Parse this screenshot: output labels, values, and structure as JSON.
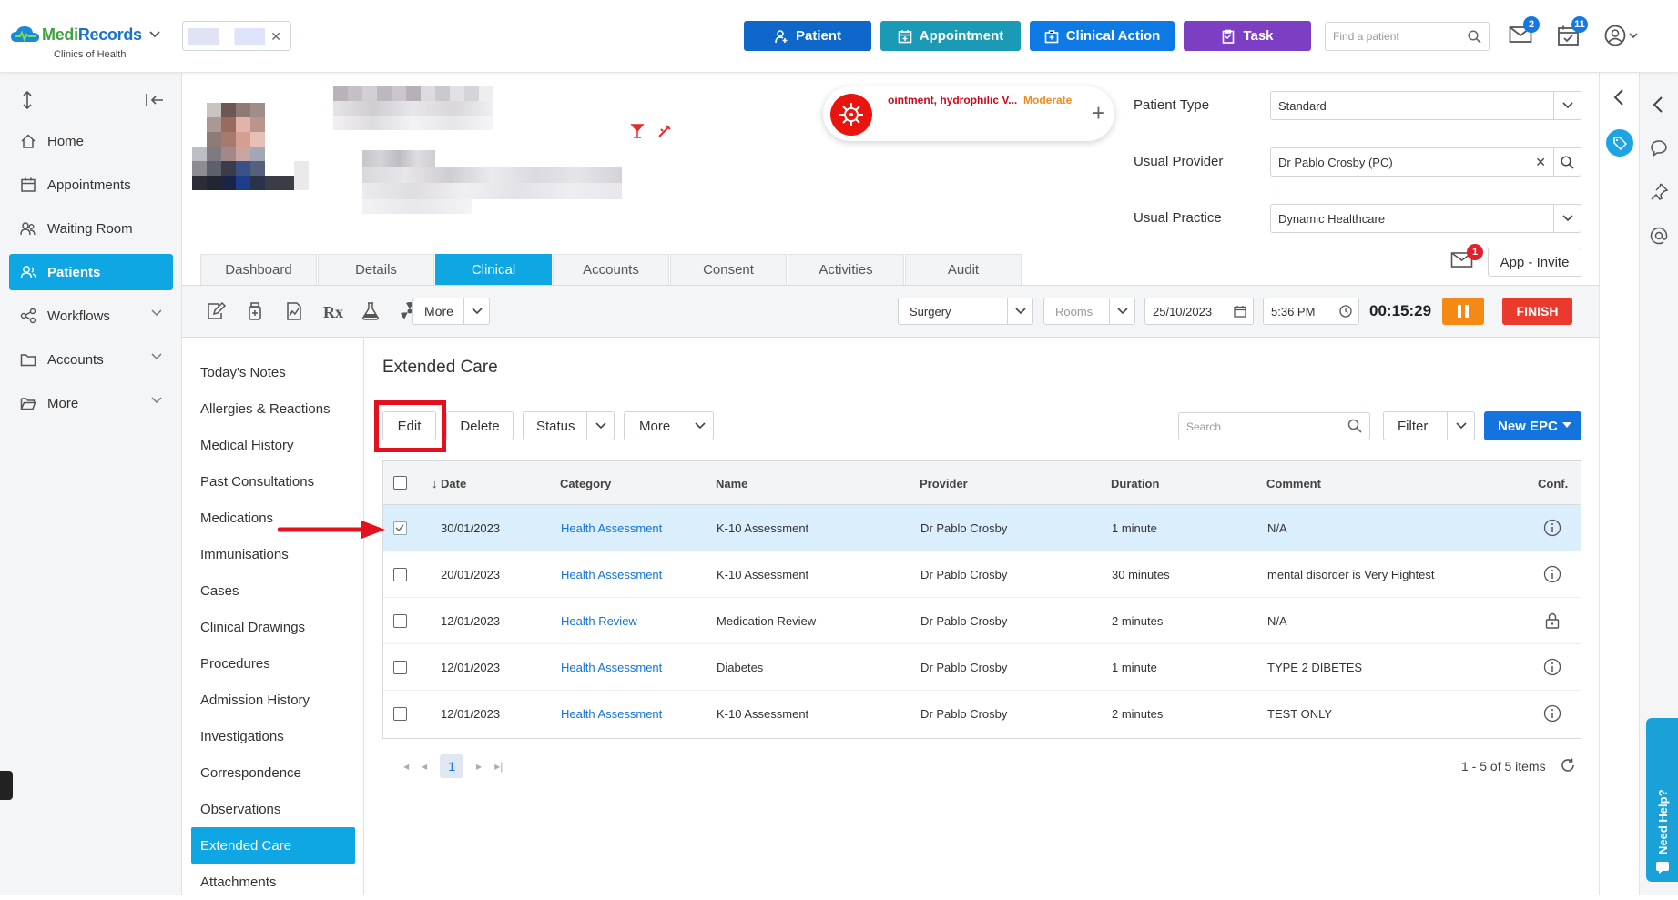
{
  "brand": {
    "name_part1": "Medi",
    "name_part2": "Records",
    "subtitle": "Clinics of Health"
  },
  "header": {
    "buttons": {
      "patient": "Patient",
      "appointment": "Appointment",
      "clinical_action": "Clinical Action",
      "task": "Task"
    },
    "find_patient_placeholder": "Find a patient",
    "mail_badge": "2",
    "tasks_badge": "11"
  },
  "sidebar": {
    "items": [
      {
        "label": "Home"
      },
      {
        "label": "Appointments"
      },
      {
        "label": "Waiting Room"
      },
      {
        "label": "Patients"
      },
      {
        "label": "Workflows"
      },
      {
        "label": "Accounts"
      },
      {
        "label": "More"
      }
    ]
  },
  "patient": {
    "alert": {
      "allergen": "ointment, hydrophilic V...",
      "severity": "Moderate"
    },
    "fields": {
      "patient_type_label": "Patient Type",
      "patient_type_value": "Standard",
      "usual_provider_label": "Usual Provider",
      "usual_provider_value": "Dr Pablo Crosby (PC)",
      "usual_practice_label": "Usual Practice",
      "usual_practice_value": "Dynamic Healthcare"
    },
    "tabs": [
      "Dashboard",
      "Details",
      "Clinical",
      "Accounts",
      "Consent",
      "Activities",
      "Audit"
    ],
    "message_badge": "1",
    "app_invite": "App - Invite"
  },
  "toolbar": {
    "more": "More",
    "surgery": "Surgery",
    "rooms": "Rooms",
    "date": "25/10/2023",
    "time": "5:36 PM",
    "timer": "00:15:29",
    "finish": "FINISH"
  },
  "clinical_nav": [
    "Today's Notes",
    "Allergies & Reactions",
    "Medical History",
    "Past Consultations",
    "Medications",
    "Immunisations",
    "Cases",
    "Clinical Drawings",
    "Procedures",
    "Admission History",
    "Investigations",
    "Correspondence",
    "Observations",
    "Extended Care",
    "Attachments"
  ],
  "main": {
    "title": "Extended Care",
    "actions": {
      "edit": "Edit",
      "delete": "Delete",
      "status": "Status",
      "more": "More",
      "filter": "Filter",
      "new_epc": "New EPC"
    },
    "search_placeholder": "Search",
    "columns": [
      "Date",
      "Category",
      "Name",
      "Provider",
      "Duration",
      "Comment",
      "Conf."
    ],
    "rows": [
      {
        "date": "30/01/2023",
        "category": "Health Assessment",
        "name": "K-10 Assessment",
        "provider": "Dr Pablo Crosby",
        "duration": "1 minute",
        "comment": "N/A",
        "conf": "info-icon"
      },
      {
        "date": "20/01/2023",
        "category": "Health Assessment",
        "name": "K-10 Assessment",
        "provider": "Dr Pablo Crosby",
        "duration": "30 minutes",
        "comment": "mental disorder is Very Hightest",
        "conf": "info-icon"
      },
      {
        "date": "12/01/2023",
        "category": "Health Review",
        "name": "Medication Review",
        "provider": "Dr Pablo Crosby",
        "duration": "2 minutes",
        "comment": "N/A",
        "conf": "lock-icon"
      },
      {
        "date": "12/01/2023",
        "category": "Health Assessment",
        "name": "Diabetes",
        "provider": "Dr Pablo Crosby",
        "duration": "1 minute",
        "comment": "TYPE 2 DIBETES",
        "conf": "info-icon"
      },
      {
        "date": "12/01/2023",
        "category": "Health Assessment",
        "name": "K-10 Assessment",
        "provider": "Dr Pablo Crosby",
        "duration": "2 minutes",
        "comment": "TEST ONLY",
        "conf": "info-icon"
      }
    ],
    "pager": {
      "page": "1",
      "info": "1 - 5 of 5 items"
    }
  },
  "need_help": "Need Help?",
  "colors": {
    "primary": "#0e67c9",
    "accent": "#0fa6e4",
    "highlight": "#e3101d",
    "task": "#7c3fc4"
  }
}
